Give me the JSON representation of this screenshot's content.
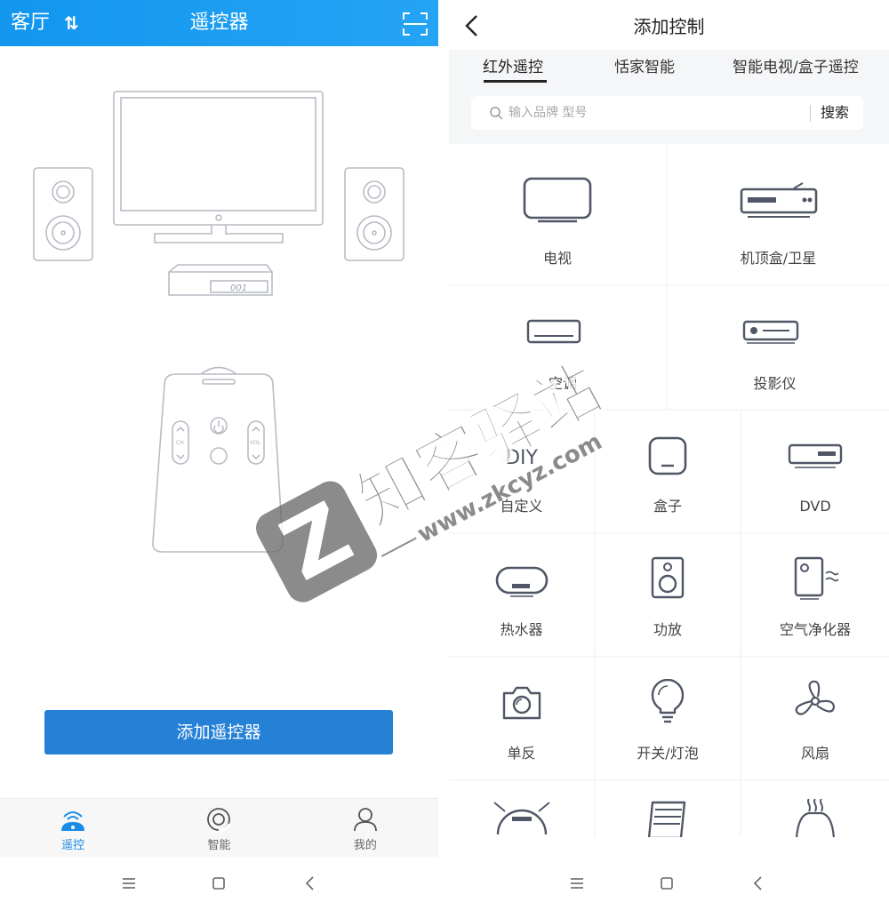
{
  "left": {
    "header": {
      "room": "客厅",
      "swap_glyph": "⇅",
      "title": "遥控器",
      "scan_icon": "scan-icon"
    },
    "illustration": {
      "set_top_box_display": "001",
      "remote_left_label": "CH",
      "remote_right_label": "VOL"
    },
    "add_button": "添加遥控器",
    "tabs": [
      {
        "label": "遥控",
        "icon": "remote-wifi-icon",
        "active": true
      },
      {
        "label": "智能",
        "icon": "smart-ring-icon",
        "active": false
      },
      {
        "label": "我的",
        "icon": "person-icon",
        "active": false
      }
    ],
    "accent": "#2481d6"
  },
  "right": {
    "header": {
      "title": "添加控制"
    },
    "tabs": [
      "红外遥控",
      "恬家智能",
      "智能电视/盒子遥控"
    ],
    "search": {
      "placeholder": "输入品牌 型号",
      "button": "搜索"
    },
    "devices_row1": [
      "电视",
      "机顶盒/卫星"
    ],
    "devices_row2": [
      "空调",
      "投影仪"
    ],
    "devices_grid": [
      [
        "自定义",
        "盒子",
        "DVD"
      ],
      [
        "热水器",
        "功放",
        "空气净化器"
      ],
      [
        "单反",
        "开关/灯泡",
        "风扇"
      ]
    ],
    "diy_text": "DIY"
  },
  "watermark": {
    "brand": "知客驿站",
    "url": "www.zkcyz.com",
    "letter": "Z"
  }
}
